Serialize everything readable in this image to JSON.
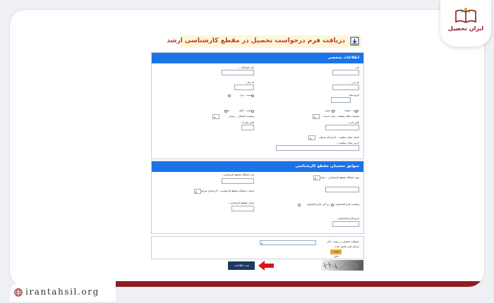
{
  "brand": {
    "logo_text": "ایران تحصیل",
    "website": "irantahsil.org",
    "accent_color": "#8b1d22"
  },
  "page": {
    "title": "دریافت فرم درخواست تحصیل در مقطع کارشناسی ارشد"
  },
  "personal": {
    "header": "اطلاعات شخصی",
    "name": "نام :",
    "family": "نام خانوادگی :",
    "father": "نام پدر :",
    "national_code": "کد ملی :",
    "birth_date": "تاریخ تولد :",
    "gender": "جنسیت : مرد",
    "gender_female": "زن",
    "religion": "مذهب : شیعه",
    "religion_opt": "اهل تسنن",
    "marital": "وضعیت : تأهل",
    "marital_opt": "مجرد",
    "military_status": "وضعیت نظام وظیفه : پایان خدمت",
    "employment": "وضعیت اشتغال : رسمی",
    "phone": "تلفن ثابت :",
    "mobile": "تلفن همراه :",
    "province": "استان محل سکونت : آذربایجان شرقی",
    "address": "آدرس محل سکونت :"
  },
  "education": {
    "header": "سوابق تحصیلی مقطع کارشناسی",
    "university_type": "نوع دانشگاه مقطع کارشناسی : دولتی",
    "university_name": "نام دانشگاه مقطع کارشناسی :",
    "field": "رشته تحصیلی مقطع کارشناسی :",
    "university_province": "استان دانشگاه مقطع کارشناسی : آذربایجان شرقی",
    "graduation_status": "وضعیت فارغ التحصیلی : در رو آخر",
    "graduated": "فارغ التحصیل",
    "gpa": "معدل مقطع کارشناسی :",
    "graduation_date": "تاریخ فارغ التحصیلی :"
  },
  "request": {
    "field_request": "داوطلب تحصیل در رشته : آمار",
    "file_label": "ارسال فرم تکمیل شده :",
    "upload_button": "انتخاب فایل"
  },
  "actions": {
    "submit": "ثبت اطلاعات"
  }
}
